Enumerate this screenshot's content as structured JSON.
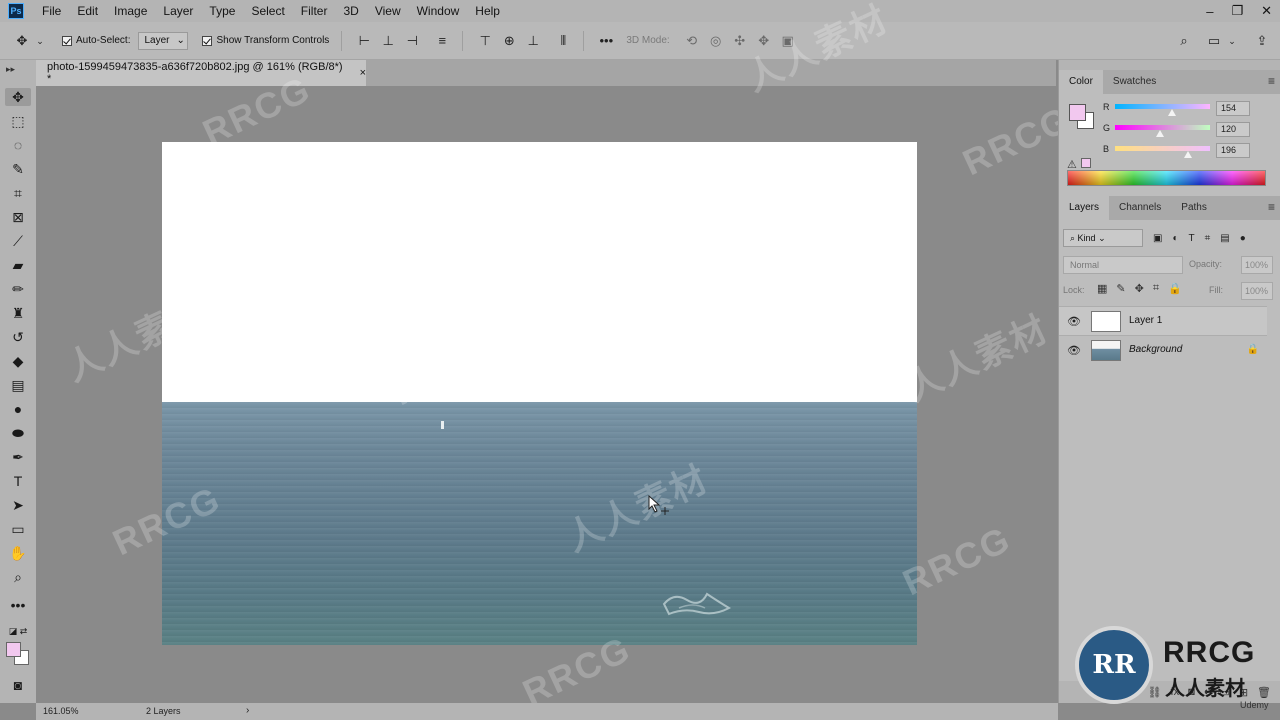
{
  "app": {
    "logo_text": "Ps",
    "menu": [
      "File",
      "Edit",
      "Image",
      "Layer",
      "Type",
      "Select",
      "Filter",
      "3D",
      "View",
      "Window",
      "Help"
    ],
    "window_controls": [
      "–",
      "❐",
      "✕"
    ]
  },
  "options_bar": {
    "auto_select_label": "Auto-Select:",
    "auto_select_target": "Layer",
    "show_transform_label": "Show Transform Controls",
    "mode_label": "3D Mode:"
  },
  "document": {
    "tab_title": "photo-1599459473835-a636f720b802.jpg @ 161% (RGB/8*) *",
    "close": "×"
  },
  "color_panel": {
    "tabs": [
      "Color",
      "Swatches"
    ],
    "foreground_color": "#f2c8ef",
    "channels": [
      {
        "label": "R",
        "value": "154",
        "fraction": 0.604
      },
      {
        "label": "G",
        "value": "120",
        "fraction": 0.471
      },
      {
        "label": "B",
        "value": "196",
        "fraction": 0.769
      }
    ]
  },
  "layers_panel": {
    "tabs": [
      "Layers",
      "Channels",
      "Paths"
    ],
    "kind_filter": "Kind",
    "blend_mode": "Normal",
    "opacity_label": "Opacity:",
    "opacity_value": "100%",
    "lock_label": "Lock:",
    "fill_label": "Fill:",
    "fill_value": "100%",
    "layers": [
      {
        "name": "Layer 1",
        "visible": true,
        "locked": false
      },
      {
        "name": "Background",
        "visible": true,
        "locked": true
      }
    ]
  },
  "status": {
    "zoom": "161.05%",
    "info": "2 Layers"
  },
  "watermark": {
    "latin": "RRCG",
    "cjk": "人人素材",
    "brand_sub": "人人素材",
    "udemy": "Udemy"
  }
}
